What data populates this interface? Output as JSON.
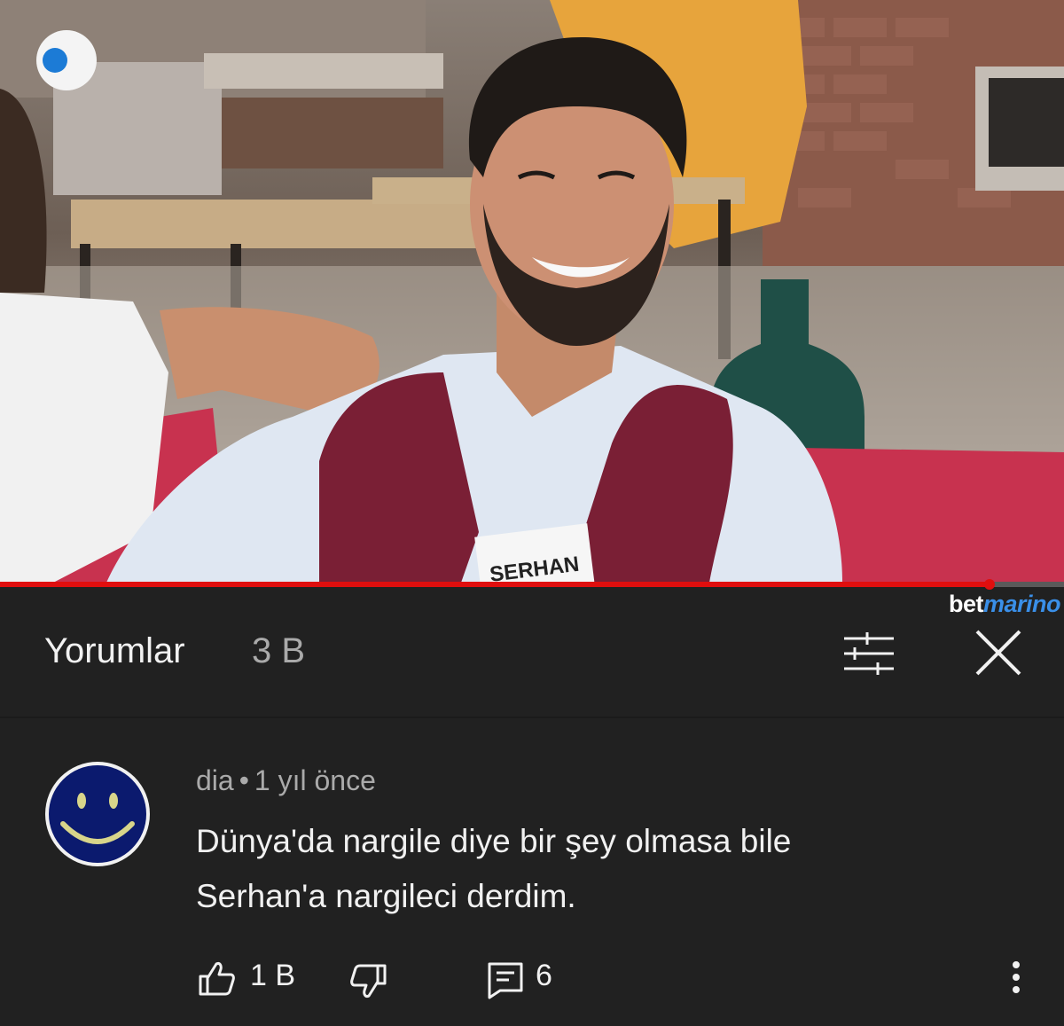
{
  "video": {
    "name_tag": "SERHAN",
    "sponsor_part1": "bet",
    "sponsor_part2": "marino",
    "progress_fraction": 0.93
  },
  "comments_panel": {
    "title": "Yorumlar",
    "count": "3 B",
    "icons": {
      "filter": "tune-icon",
      "close": "close-icon"
    }
  },
  "comment": {
    "author": "dia",
    "separator": "•",
    "time": "1 yıl önce",
    "text_line1": "Dünya'da nargile diye bir şey olmasa bile",
    "text_line2": "Serhan'a nargileci derdim.",
    "likes": "1 B",
    "replies": "6",
    "avatar": "smiley-face-icon",
    "icons": {
      "like": "thumbs-up-icon",
      "dislike": "thumbs-down-icon",
      "reply": "comment-icon",
      "more": "more-vertical-icon"
    }
  },
  "colors": {
    "background": "#212121",
    "progress": "#e00e0e",
    "avatar_bg": "#0b1a6e",
    "avatar_face": "#d8d58a",
    "vest": "#7a1f35",
    "sofa": "#c8324f"
  }
}
